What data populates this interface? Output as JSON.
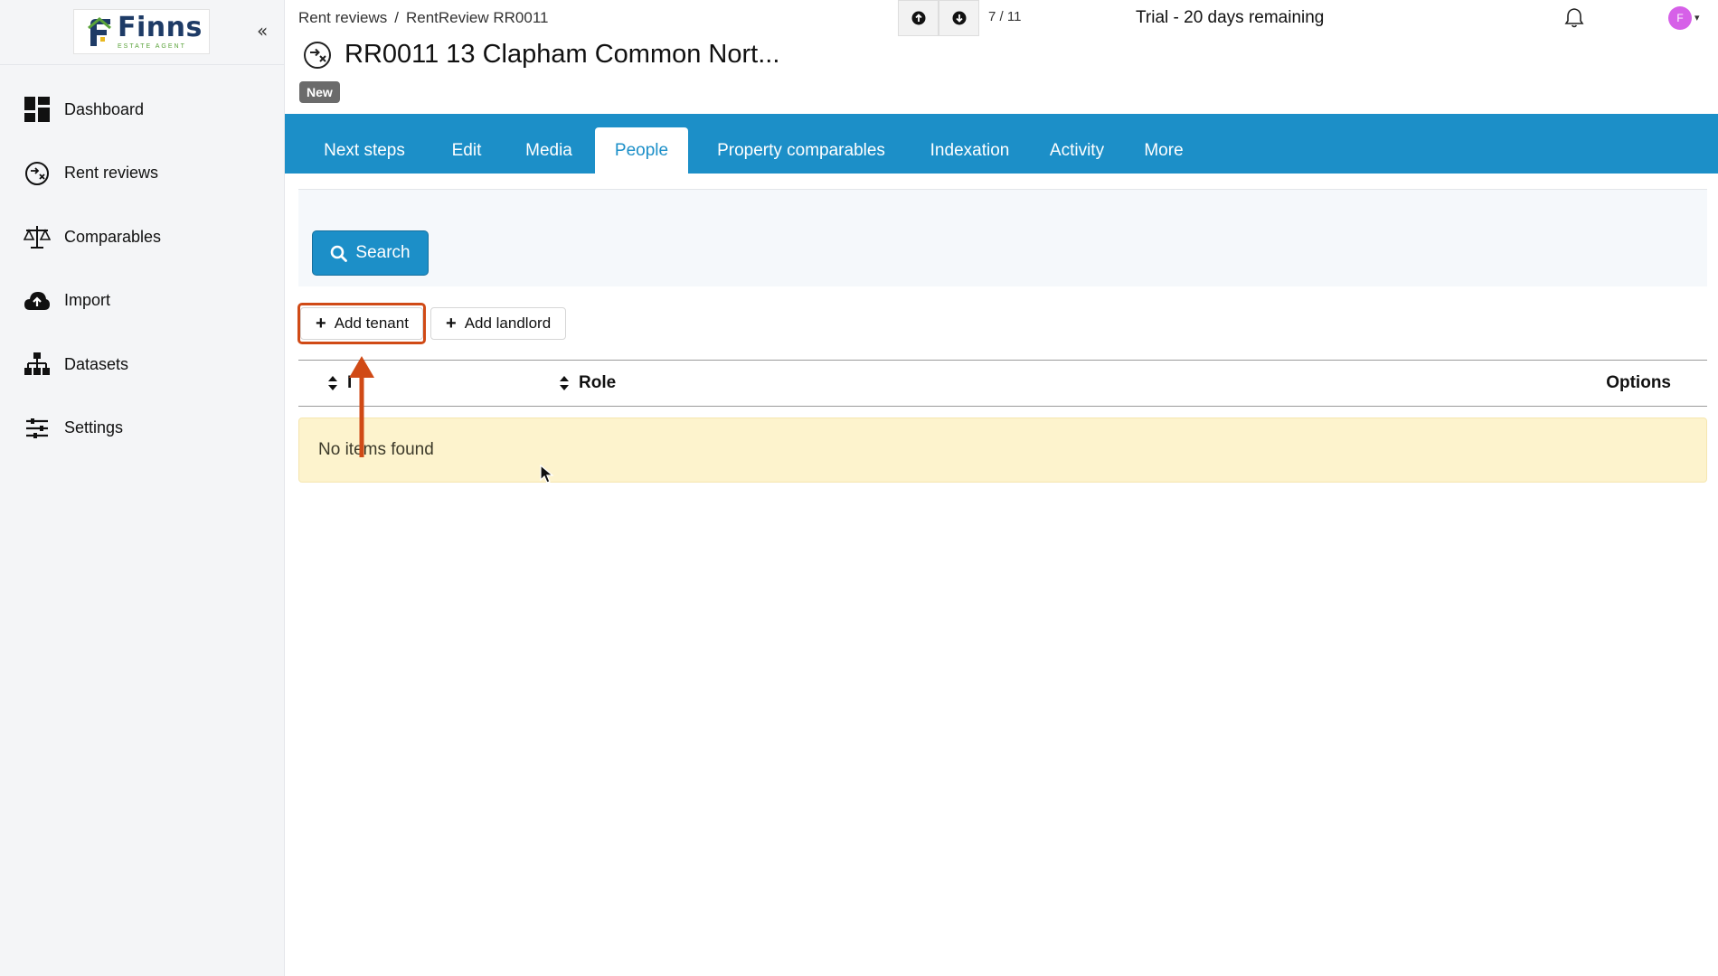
{
  "brand": {
    "name": "Finns",
    "tagline": "ESTATE AGENT",
    "colors": {
      "navy": "#1e3b66",
      "green": "#5aa33a"
    }
  },
  "sidebar": {
    "collapse_label": "«",
    "items": [
      {
        "label": "Dashboard",
        "icon": "dashboard-icon"
      },
      {
        "label": "Rent reviews",
        "icon": "rent-review-icon"
      },
      {
        "label": "Comparables",
        "icon": "scales-icon"
      },
      {
        "label": "Import",
        "icon": "cloud-upload-icon"
      },
      {
        "label": "Datasets",
        "icon": "hierarchy-icon"
      },
      {
        "label": "Settings",
        "icon": "sliders-icon"
      }
    ]
  },
  "header": {
    "breadcrumb": [
      "Rent reviews",
      "RentReview RR0011"
    ],
    "breadcrumb_separator": "/",
    "record_position": "7 / 11",
    "trial_text": "Trial - 20 days remaining",
    "avatar_initial": "F",
    "avatar_caret": "▾",
    "title": "RR0011 13 Clapham Common Nort...",
    "status": "New"
  },
  "tabs": [
    {
      "label": "Next steps",
      "active": false
    },
    {
      "label": "Edit",
      "active": false
    },
    {
      "label": "Media",
      "active": false
    },
    {
      "label": "People",
      "active": true
    },
    {
      "label": "Property comparables",
      "active": false
    },
    {
      "label": "Indexation",
      "active": false
    },
    {
      "label": "Activity",
      "active": false
    },
    {
      "label": "More",
      "active": false
    }
  ],
  "content": {
    "search_label": "Search",
    "add_tenant_label": "Add tenant",
    "add_landlord_label": "Add landlord",
    "columns": {
      "name": "I",
      "role": "Role",
      "options": "Options"
    },
    "empty_message": "No items found"
  },
  "colors": {
    "accent": "#1c8fc8",
    "highlight": "#d04a16",
    "empty_bg": "#fdf3cd"
  }
}
